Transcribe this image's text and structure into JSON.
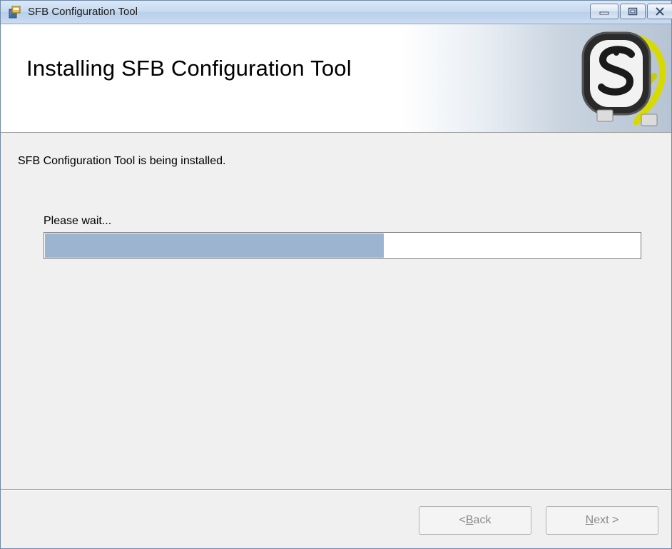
{
  "window": {
    "title": "SFB Configuration Tool",
    "icon": "installer-icon",
    "controls": {
      "minimize": "minimize-icon",
      "maximize": "maximize-icon",
      "close": "close-icon"
    }
  },
  "header": {
    "title": "Installing SFB Configuration Tool",
    "logo": "sfb-logo"
  },
  "main": {
    "status_text": "SFB Configuration Tool is being installed.",
    "wait_text": "Please wait...",
    "progress_fraction": 0.57,
    "progress_color": "#9db4d1"
  },
  "buttons": {
    "back": {
      "prefix": "< ",
      "mnemonic": "B",
      "rest": "ack",
      "enabled": false
    },
    "next": {
      "mnemonic": "N",
      "rest": "ext >",
      "enabled": false
    }
  }
}
